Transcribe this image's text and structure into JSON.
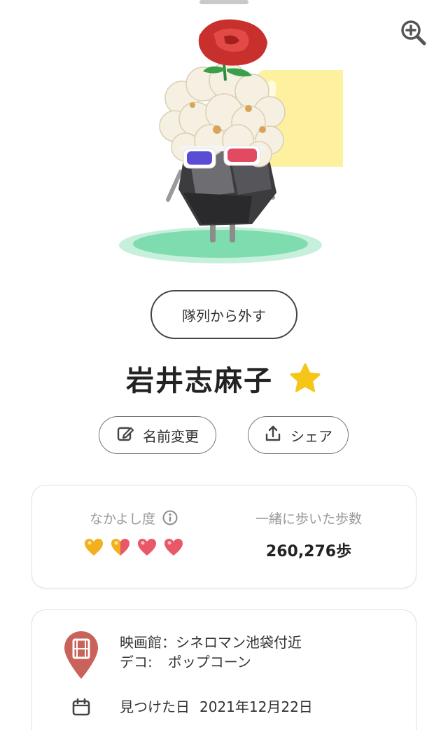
{
  "icons": {
    "zoom": "zoom-in-icon",
    "star": "star-icon",
    "rename": "edit-icon",
    "share": "share-icon",
    "info": "info-icon",
    "pin": "film-location-pin-icon",
    "calendar": "calendar-icon"
  },
  "colors": {
    "star": "#f5c518",
    "pin": "#c9625a",
    "heart_full": "#e95868",
    "heart_gold": "#f2b01e",
    "platform": "#7fdcae"
  },
  "buttons": {
    "leave_party": "隊列から外す",
    "rename": "名前変更",
    "share": "シェア"
  },
  "pikmin": {
    "name": "岩井志麻子",
    "is_favorite": true
  },
  "stats": {
    "friendship_label": "なかよし度",
    "friendship_hearts": 4,
    "friendship_level_text": "",
    "steps_label": "一緒に歩いた歩数",
    "steps_value": "260,276歩"
  },
  "info": {
    "place_line": "映画館：シネロマン池袋付近",
    "deco_label": "デコ:",
    "deco_value": "ポップコーン",
    "found_label": "見つけた日",
    "found_date": "2021年12月22日"
  }
}
